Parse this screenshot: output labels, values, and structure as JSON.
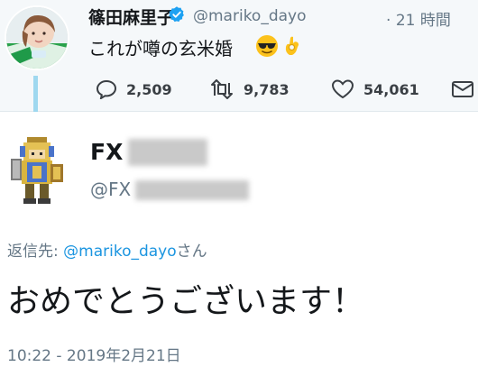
{
  "original_tweet": {
    "display_name": "篠田麻里子",
    "handle": "@mariko_dayo",
    "relative_time": "21 時間",
    "text": "これが噂の玄米婚",
    "emojis": [
      "sunglasses-face",
      "ok-hand"
    ],
    "counts": {
      "replies": "2,509",
      "retweets": "9,783",
      "likes": "54,061"
    }
  },
  "reply_tweet": {
    "display_name_visible": "FX",
    "handle_visible": "@FX",
    "replying_prefix": "返信先:",
    "replying_handle": "@mariko_dayo",
    "replying_suffix": "さん",
    "text": "おめでとうございます！",
    "timestamp": "10:22 - 2019年2月21日"
  },
  "colors": {
    "link": "#1b95e0",
    "muted": "#657786",
    "thread_line": "#9fd8ef",
    "verified": "#1da1f2"
  }
}
